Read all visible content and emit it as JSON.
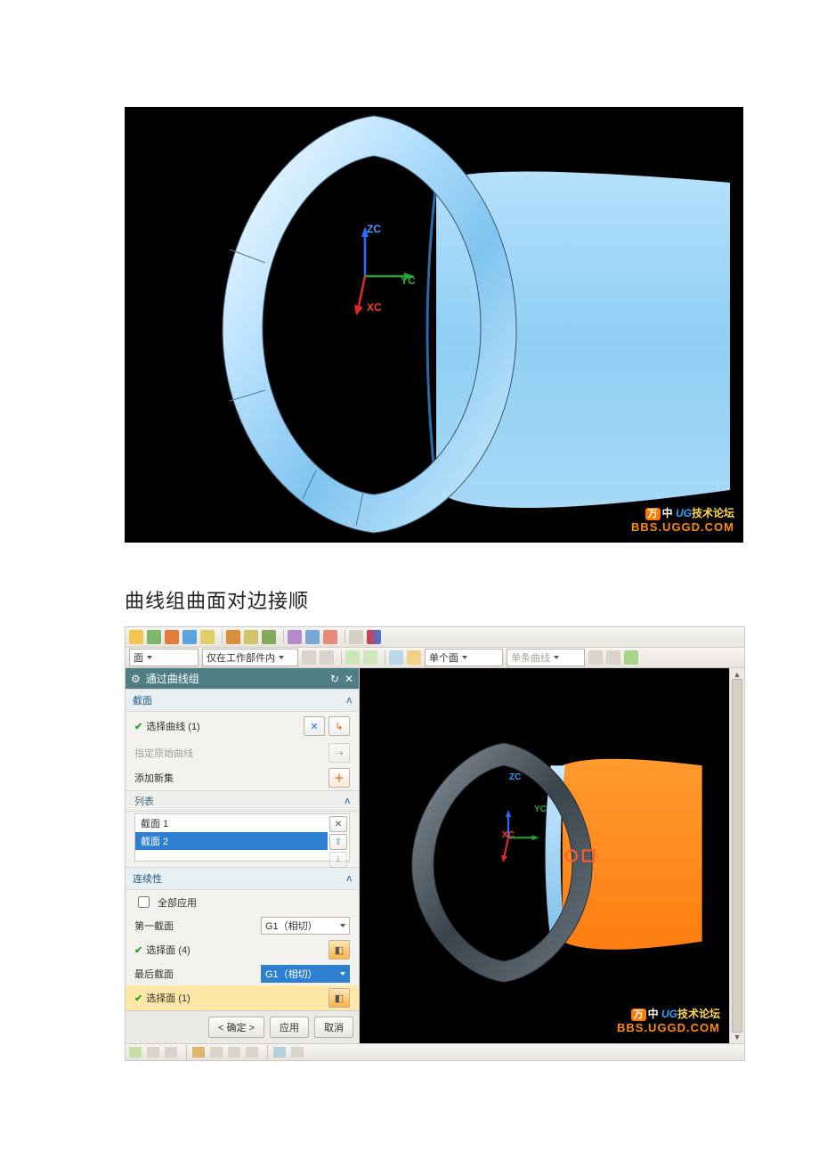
{
  "caption": "曲线组曲面对边接顺",
  "axes": {
    "z": "ZC",
    "y": "YC",
    "x": "XC"
  },
  "watermark": {
    "badge": "万",
    "mid": "中",
    "ug": "UG",
    "suffix": "技术论坛",
    "url": "BBS.UGGD.COM"
  },
  "toolbar2": {
    "filter_type": "面",
    "scope": "仅在工作部件内",
    "face_mode": "单个面",
    "curve_mode": "单条曲线"
  },
  "dialog": {
    "title": "通过曲线组",
    "sec_section": "截面",
    "select_curve": "选择曲线 (1)",
    "specify_origin": "指定原始曲线",
    "add_new_set": "添加新集",
    "list_header": "列表",
    "list_items": [
      "截面 1",
      "截面 2"
    ],
    "continuity": "连续性",
    "apply_all": "全部应用",
    "first_section": "第一截面",
    "g1_tangent": "G1（相切）",
    "select_face4": "选择面 (4)",
    "last_section": "最后截面",
    "select_face1": "选择面 (1)",
    "ok": "< 确定 >",
    "apply": "应用",
    "cancel": "取消"
  }
}
